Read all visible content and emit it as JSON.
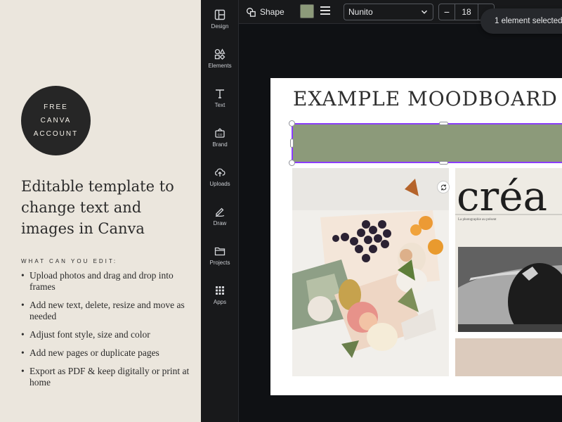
{
  "promo": {
    "badge": [
      "FREE",
      "CANVA",
      "ACCOUNT"
    ],
    "headline": [
      "Editable template to",
      "change text and",
      "images in Canva"
    ],
    "subhead": "WHAT CAN YOU EDIT:",
    "bullets": [
      "Upload photos and drag and drop into frames",
      "Add new text, delete, resize and move as needed",
      "Adjust font style, size and color",
      "Add new pages or duplicate pages",
      "Export as PDF & keep digitally or print at home"
    ]
  },
  "rail": {
    "items": [
      {
        "label": "Design",
        "icon": "layout-icon"
      },
      {
        "label": "Elements",
        "icon": "shapes-icon"
      },
      {
        "label": "Text",
        "icon": "text-icon"
      },
      {
        "label": "Brand",
        "icon": "brand-icon"
      },
      {
        "label": "Uploads",
        "icon": "upload-cloud-icon"
      },
      {
        "label": "Draw",
        "icon": "pen-icon"
      },
      {
        "label": "Projects",
        "icon": "folder-icon"
      },
      {
        "label": "Apps",
        "icon": "apps-grid-icon"
      }
    ]
  },
  "toolbar": {
    "shape_label": "Shape",
    "fill_color": "#8c9a7a",
    "font": "Nunito",
    "font_size": "18",
    "minus": "−",
    "toast": "1 element selected"
  },
  "canvas": {
    "title": "EXAMPLE MOODBOARD",
    "bar_color": "#8c9a7a",
    "selection_color": "#8b3dff",
    "creat_word": "créa",
    "creat_caption": "La photographie au présent"
  }
}
